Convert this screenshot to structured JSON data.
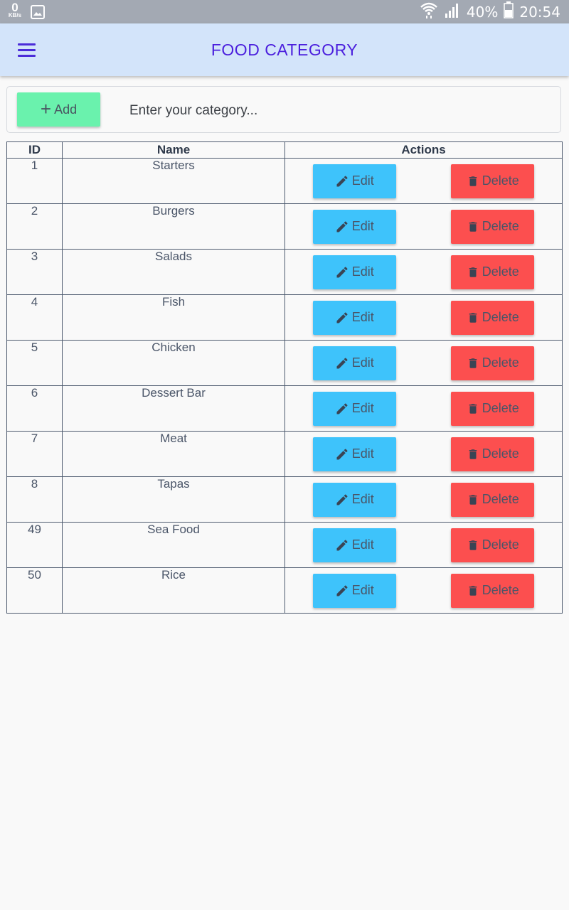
{
  "status_bar": {
    "network_speed": "0",
    "network_unit": "KB/s",
    "battery": "40%",
    "time": "20:54"
  },
  "header": {
    "title": "FOOD CATEGORY"
  },
  "add_bar": {
    "add_label": "Add",
    "placeholder": "Enter your category..."
  },
  "table": {
    "headers": [
      "ID",
      "Name",
      "Actions"
    ],
    "edit_label": "Edit",
    "delete_label": "Delete",
    "rows": [
      {
        "id": "1",
        "name": "Starters"
      },
      {
        "id": "2",
        "name": "Burgers"
      },
      {
        "id": "3",
        "name": "Salads"
      },
      {
        "id": "4",
        "name": "Fish"
      },
      {
        "id": "5",
        "name": "Chicken"
      },
      {
        "id": "6",
        "name": "Dessert Bar"
      },
      {
        "id": "7",
        "name": "Meat"
      },
      {
        "id": "8",
        "name": "Tapas"
      },
      {
        "id": "49",
        "name": "Sea Food"
      },
      {
        "id": "50",
        "name": "Rice"
      }
    ]
  },
  "colors": {
    "appbar": "#d3e4fa",
    "title": "#4b1fdd",
    "add_button": "#6af2ad",
    "edit_button": "#3ec3fb",
    "delete_button": "#fc4f4f"
  },
  "icons": {
    "menu": "hamburger-menu-icon",
    "add": "plus-icon",
    "edit": "pencil-icon",
    "delete": "trash-icon"
  }
}
